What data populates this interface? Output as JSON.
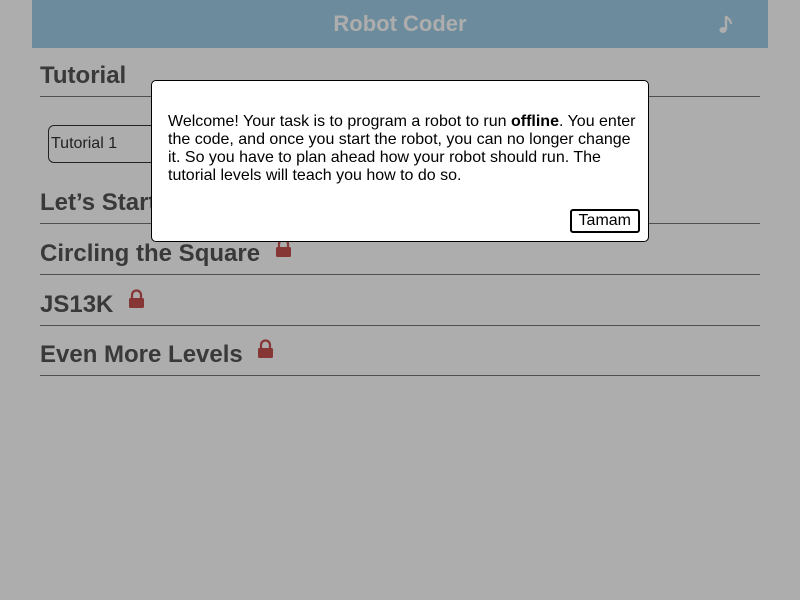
{
  "header": {
    "title": "Robot Coder",
    "music_icon": "music-note-icon"
  },
  "sections": [
    {
      "title": "Tutorial",
      "locked": false,
      "levels": [
        "Tutorial 1"
      ]
    },
    {
      "title": "Let’s Start",
      "locked": false
    },
    {
      "title": "Circling the Square",
      "locked": true
    },
    {
      "title": "JS13K",
      "locked": true
    },
    {
      "title": "Even More Levels",
      "locked": true
    }
  ],
  "dialog": {
    "text_before": "Welcome! Your task is to program a robot to run ",
    "text_bold": "offline",
    "text_after": ". You enter the code, and once you start the robot, you can no longer change it. So you have to plan ahead how your robot should run. The tutorial levels will teach you how to do so.",
    "ok_label": "Tamam"
  },
  "colors": {
    "header_bg": "#9fcfe9",
    "header_text": "#ffffff",
    "section_text": "#555555",
    "lock": "#c85050",
    "overlay": "rgba(0,0,0,0.32)"
  }
}
